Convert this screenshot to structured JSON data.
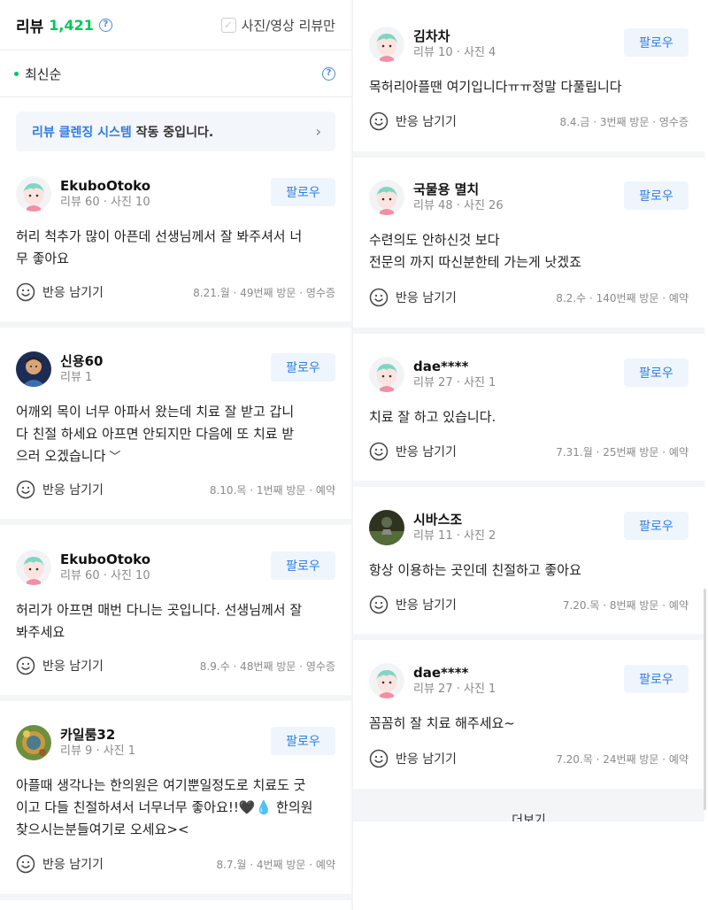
{
  "header": {
    "title": "리뷰",
    "count": "1,421",
    "filter_label": "사진/영상 리뷰만",
    "sort_label": "최신순",
    "banner_highlight": "리뷰 클렌징 시스템",
    "banner_text": " 작동 중입니다."
  },
  "react_label": "반응 남기기",
  "follow_label": "팔로우",
  "more_label": "더보기",
  "icons": {
    "help": "help-icon",
    "check": "check-icon",
    "smile": "smile-icon",
    "chevron": "chevron-right-icon"
  },
  "colors": {
    "green": "#03c75a",
    "blue": "#2f7de1"
  },
  "left_reviews": [
    {
      "name": "EkuboOtoko",
      "stats": "리뷰 60 · 사진 10",
      "lines": [
        "허리 척추가 많이 아픈데 선생님께서 잘 봐주셔서 너",
        "무 좋아요"
      ],
      "visit": "8.21.월 · 49번째 방문 · 영수증",
      "avatar": "mint"
    },
    {
      "name": "신용60",
      "stats": "리뷰 1",
      "lines": [
        "어깨외 목이 너무 아파서 왔는데 치료 잘 받고 갑니",
        "다 친절 하세요 아프면 안되지만 다음에 또 치료 받",
        "으러 오겠습니다"
      ],
      "visit": "8.10.목 · 1번째 방문 · 예약",
      "avatar": "photo-person"
    },
    {
      "name": "EkuboOtoko",
      "stats": "리뷰 60 · 사진 10",
      "lines": [
        "허리가 아프면 매번 다니는 곳입니다. 선생님께서 잘",
        "봐주세요"
      ],
      "visit": "8.9.수 · 48번째 방문 · 영수증",
      "avatar": "mint"
    },
    {
      "name": "카일룸32",
      "stats": "리뷰 9 · 사진 1",
      "lines": [
        "아플때 생각나는 한의원은 여기뿐일정도로 치료도 굿",
        "이고 다들 친절하셔서 너무너무 좋아요!!🖤💧 한의원",
        "찾으시는분들여기로 오세요><"
      ],
      "visit": "8.7.월 · 4번째 방문 · 예약",
      "avatar": "photo-green"
    }
  ],
  "right_reviews": [
    {
      "name": "김차차",
      "stats": "리뷰 10 · 사진 4",
      "lines": [
        "목허리아플땐 여기입니다ㅠㅠ정말 다풀립니다"
      ],
      "visit": "8.4.금 · 3번째 방문 · 영수증",
      "avatar": "mint"
    },
    {
      "name": "국물용 멸치",
      "stats": "리뷰 48 · 사진 26",
      "lines": [
        "수련의도 안하신것 보다",
        "전문의 까지 따신분한테 가는게 낫겠죠"
      ],
      "visit": "8.2.수 · 140번째 방문 · 예약",
      "avatar": "mint"
    },
    {
      "name": "dae****",
      "stats": "리뷰 27 · 사진 1",
      "lines": [
        "치료 잘 하고 있습니다."
      ],
      "visit": "7.31.월 · 25번째 방문 · 예약",
      "avatar": "mint"
    },
    {
      "name": "시바스조",
      "stats": "리뷰 11 · 사진 2",
      "lines": [
        "항상 이용하는 곳인데 친절하고 좋아요"
      ],
      "visit": "7.20.목 · 8번째 방문 · 예약",
      "avatar": "photo-dark"
    },
    {
      "name": "dae****",
      "stats": "리뷰 27 · 사진 1",
      "lines": [
        "꼼꼼히 잘 치료 해주세요~"
      ],
      "visit": "7.20.목 · 24번째 방문 · 예약",
      "avatar": "mint"
    }
  ]
}
